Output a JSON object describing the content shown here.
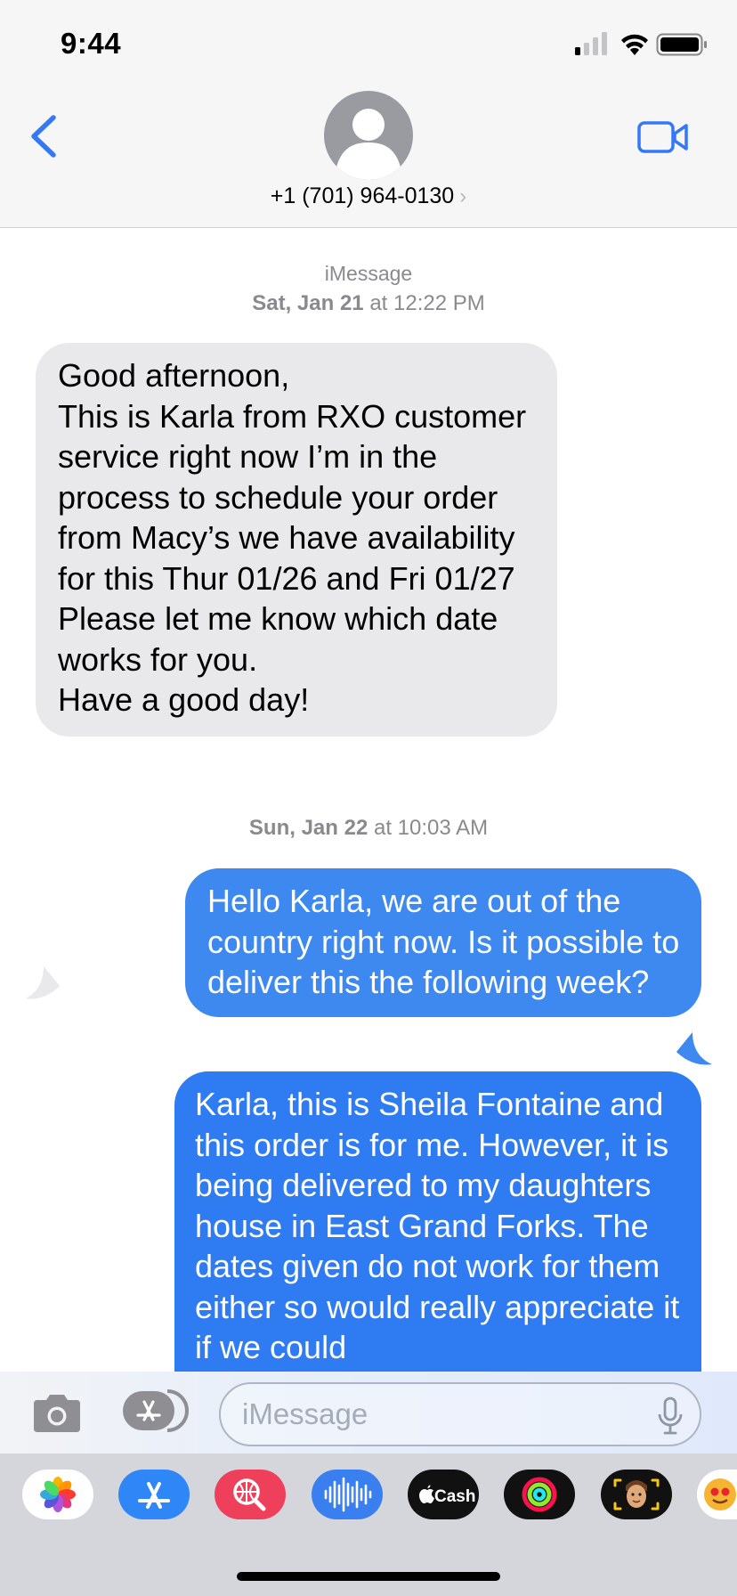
{
  "status_bar": {
    "time": "9:44"
  },
  "header": {
    "contact": "+1 (701) 964-0130",
    "chevron": "›"
  },
  "conversation": {
    "service": "iMessage",
    "stamp1": {
      "day": "Sat, Jan 21",
      "time": "at 12:22 PM"
    },
    "incoming_text": "Good afternoon,\nThis is Karla from RXO customer service right now I’m in the process to schedule your order from Macy’s we have availability for this Thur 01/26 and Fri 01/27\nPlease let me know which date works for you.\nHave a good day!",
    "stamp2": {
      "day": "Sun, Jan 22",
      "time": "at 10:03 AM"
    },
    "outgoing_1": "Hello Karla, we are out of the country right now. Is it possible to deliver this the following week?",
    "outgoing_2": "Karla, this is Sheila Fontaine and this order is for me. However, it is being delivered to my daughters house in East Grand Forks. The dates given do not work for them either so would really appreciate it if we could"
  },
  "input": {
    "placeholder": "iMessage"
  },
  "drawer": {
    "apps": [
      "photos-app-icon",
      "app-store-icon",
      "image-search-icon",
      "audio-message-icon",
      "apple-cash-icon",
      "activity-icon",
      "memoji-icon",
      "animoji-icon"
    ],
    "cash_label": "Cash"
  },
  "colors": {
    "accent": "#3478f6",
    "incoming_bubble": "#e9e9eb",
    "outgoing_bubble": "#3d89f0"
  }
}
